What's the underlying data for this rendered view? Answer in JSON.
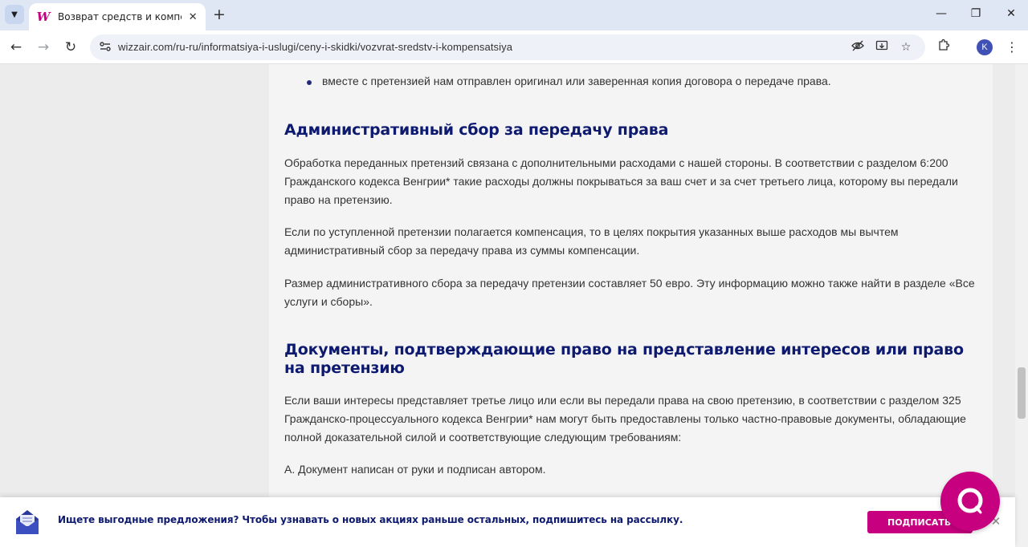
{
  "browser": {
    "tab": {
      "title": "Возврат средств и компенсац",
      "close": "✕"
    },
    "new_tab": "+",
    "window": {
      "minimize": "—",
      "restore": "❐",
      "close": "✕"
    },
    "nav": {
      "back": "←",
      "forward": "→",
      "reload": "↻"
    },
    "url": "wizzair.com/ru-ru/informatsiya-i-uslugi/ceny-i-skidki/vozvrat-sredstv-i-kompensatsiya",
    "profile_initial": "K",
    "menu": "⋮"
  },
  "article": {
    "bullet": "вместе с претензией нам отправлен оригинал или заверенная копия договора о передаче права.",
    "section1": {
      "heading": "Административный сбор за передачу права",
      "p1": "Обработка переданных претензий связана с дополнительными расходами с нашей стороны. В соответствии с разделом 6:200 Гражданского кодекса Венгрии* такие расходы должны покрываться за ваш счет и за счет третьего лица, которому вы передали право на претензию.",
      "p2": "Если по уступленной претензии полагается компенсация, то в целях покрытия указанных выше расходов мы вычтем административный сбор за передачу права из суммы компенсации.",
      "p3": "Размер административного сбора за передачу претензии составляет 50 евро. Эту информацию можно также найти в разделе «Все услуги и сборы»."
    },
    "section2": {
      "heading": "Документы, подтверждающие право на представление интересов или право на претензию",
      "p1": "Если ваши интересы представляет третье лицо или если вы передали права на свою претензию, в соответствии с разделом 325 Гражданско-процессуального кодекса Венгрии* нам могут быть предоставлены только частно-правовые документы, обладающие полной доказательной силой и соответствующие следующим требованиям:",
      "p2": "A. Документ написан от руки и подписан автором."
    }
  },
  "banner": {
    "text": "Ищете выгодные предложения? Чтобы узнавать о новых акциях раньше остальных, подпишитесь на рассылку.",
    "button": "ПОДПИСАТЬСЯ",
    "close": "✕"
  },
  "colors": {
    "brand": "#c6007e",
    "heading": "#0d1a6f"
  }
}
